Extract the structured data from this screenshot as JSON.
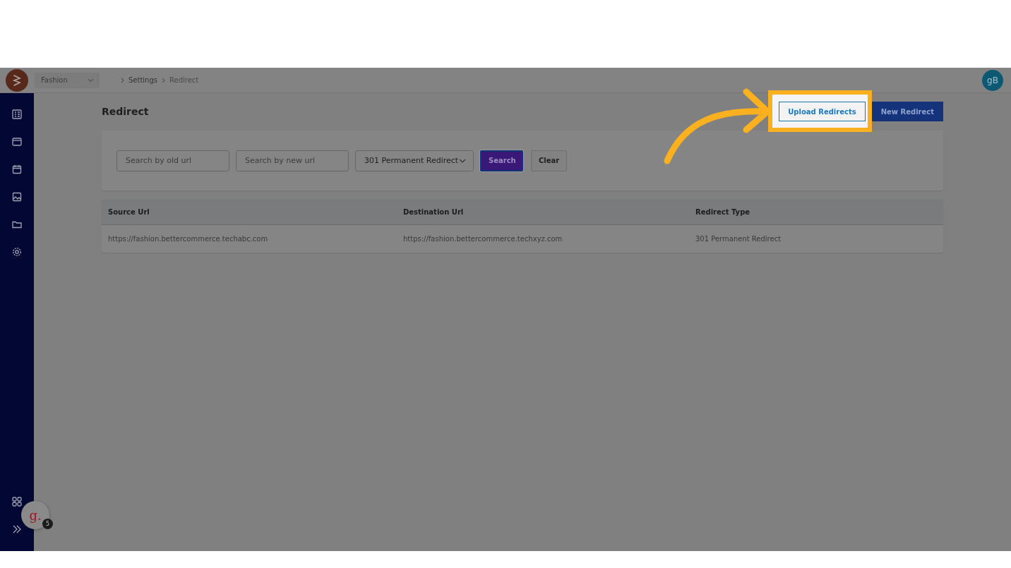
{
  "header": {
    "workspace": "Fashion",
    "breadcrumb": [
      "Settings",
      "Redirect"
    ],
    "avatar": "gB"
  },
  "page": {
    "title": "Redirect",
    "actions": [
      {
        "label": "Upload Redirects",
        "kind": "outline",
        "highlighted": true
      },
      {
        "label": "New Redirect",
        "kind": "primary",
        "highlighted": false
      }
    ]
  },
  "filters": {
    "old_url": {
      "placeholder": "Search by old url"
    },
    "new_url": {
      "placeholder": "Search by new url"
    },
    "redirect_type": {
      "value": "301 Permanent Redirect"
    },
    "buttons": [
      {
        "label": "Search",
        "kind": "primary"
      },
      {
        "label": "Clear",
        "kind": "secondary"
      }
    ]
  },
  "table": {
    "columns": [
      "Source Url",
      "Destination Url",
      "Redirect Type"
    ],
    "rows": [
      [
        "https://fashion.bettercommerce.techabc.com",
        "https://fashion.bettercommerce.techxyz.com",
        "301 Permanent Redirect"
      ]
    ]
  },
  "help_widget": {
    "logo": "g.",
    "badge": "5"
  }
}
